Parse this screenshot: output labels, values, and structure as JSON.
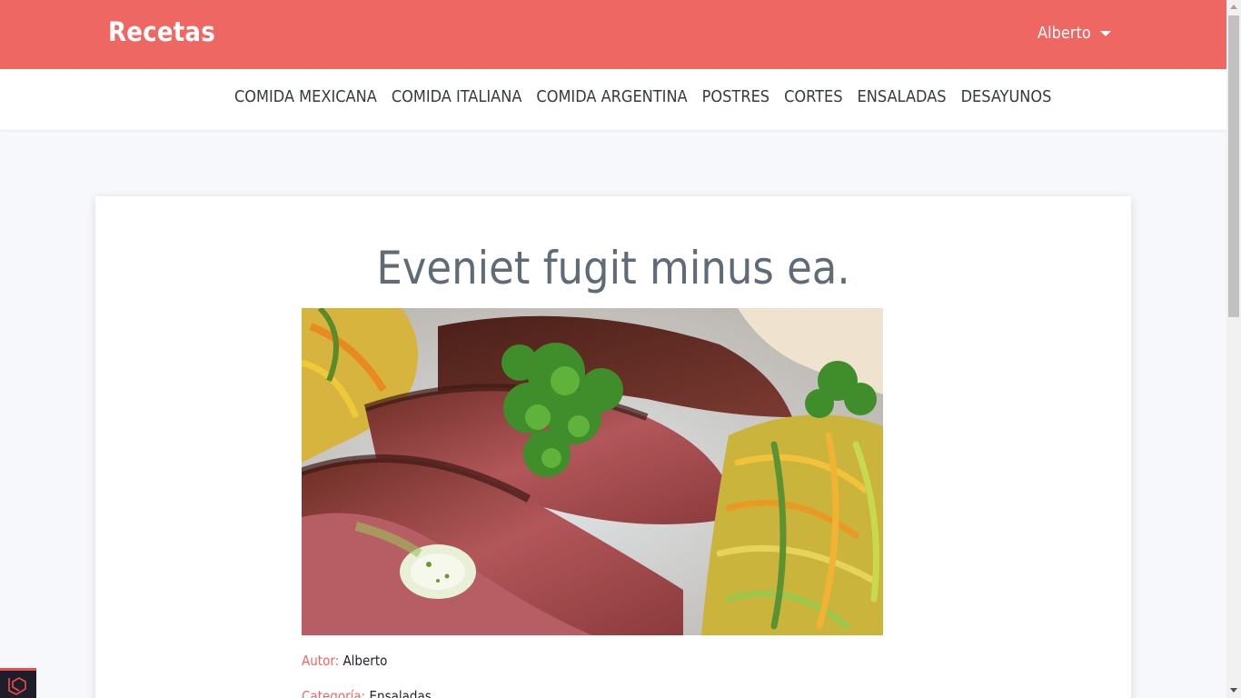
{
  "navbar": {
    "brand": "Recetas",
    "user_name": "Alberto"
  },
  "categories": [
    "COMIDA MEXICANA",
    "COMIDA ITALIANA",
    "COMIDA ARGENTINA",
    "POSTRES",
    "CORTES",
    "ENSALADAS",
    "DESAYUNOS"
  ],
  "recipe": {
    "title": "Eveniet fugit minus ea.",
    "author_label": "Autor:",
    "author": "Alberto",
    "category_label": "Categoría:",
    "category": "Ensaladas"
  },
  "colors": {
    "accent": "#ee6763",
    "background": "#f7f8fb",
    "title": "#5f6b76"
  },
  "icons": {
    "user_menu": "caret-down-icon",
    "debug_badge": "laravel-logo-icon"
  }
}
